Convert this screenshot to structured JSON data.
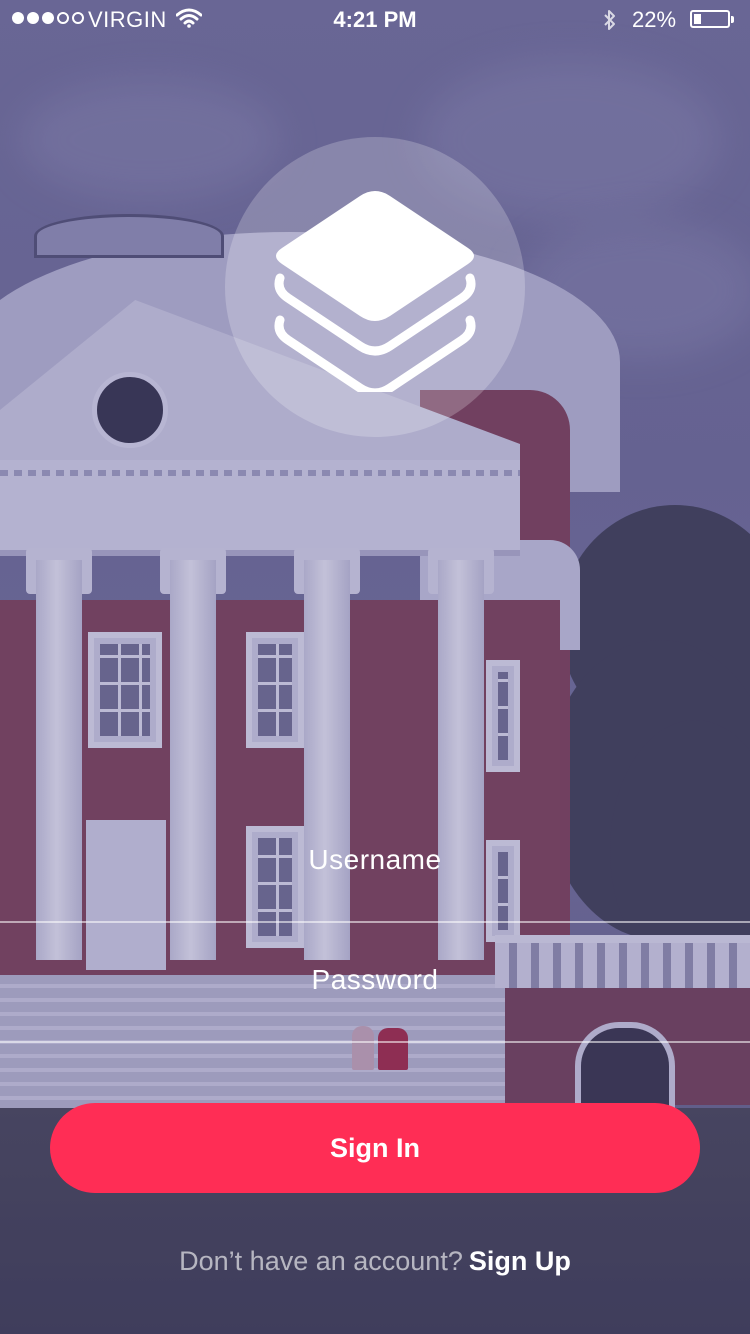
{
  "status_bar": {
    "carrier": "VIRGIN",
    "time": "4:21 PM",
    "battery": "22%",
    "battery_level": 0.22,
    "signal_bars_filled": 3,
    "signal_bars_total": 5
  },
  "logo": {
    "icon": "layers-icon"
  },
  "form": {
    "username_placeholder": "Username",
    "password_placeholder": "Password"
  },
  "sign_in": {
    "label": "Sign In"
  },
  "sign_up": {
    "prompt": "Don’t have an account?",
    "link": "Sign Up"
  },
  "colors": {
    "accent": "#ff2d55",
    "overlay": "#5c5a86"
  }
}
